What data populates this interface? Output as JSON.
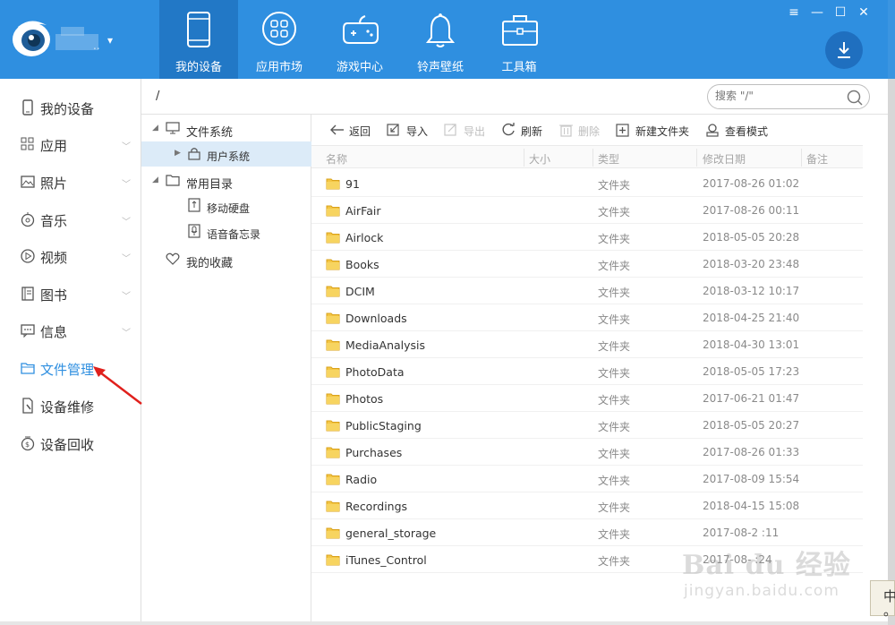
{
  "header": {
    "account_name": "..",
    "nav_tabs": [
      {
        "label": "我的设备",
        "icon": "phone-icon",
        "active": true
      },
      {
        "label": "应用市场",
        "icon": "app-grid-icon",
        "active": false
      },
      {
        "label": "游戏中心",
        "icon": "gamepad-icon",
        "active": false
      },
      {
        "label": "铃声壁纸",
        "icon": "bell-icon",
        "active": false
      },
      {
        "label": "工具箱",
        "icon": "toolbox-icon",
        "active": false
      }
    ],
    "window_controls": [
      "≡",
      "—",
      "☐",
      "✕"
    ],
    "colors": {
      "bar": "#2f8fe0",
      "active_tab": "#2278c6"
    }
  },
  "sidebar": {
    "items": [
      {
        "label": "我的设备",
        "icon": "device-icon",
        "has_chevron": false
      },
      {
        "label": "应用",
        "icon": "apps-icon",
        "has_chevron": true
      },
      {
        "label": "照片",
        "icon": "photo-icon",
        "has_chevron": true
      },
      {
        "label": "音乐",
        "icon": "music-icon",
        "has_chevron": true
      },
      {
        "label": "视频",
        "icon": "video-icon",
        "has_chevron": true
      },
      {
        "label": "图书",
        "icon": "book-icon",
        "has_chevron": true
      },
      {
        "label": "信息",
        "icon": "message-icon",
        "has_chevron": true
      },
      {
        "label": "文件管理",
        "icon": "folder-icon",
        "has_chevron": false,
        "active": true
      },
      {
        "label": "设备维修",
        "icon": "repair-icon",
        "has_chevron": false
      },
      {
        "label": "设备回收",
        "icon": "recycle-icon",
        "has_chevron": false
      }
    ],
    "active_color": "#2f8fe0"
  },
  "path": {
    "current": "/",
    "search_placeholder": "搜索 \"/\""
  },
  "tree": {
    "file_system": "文件系统",
    "user_system": "用户系统",
    "common_dirs": "常用目录",
    "mobile_disk": "移动硬盘",
    "voice_memo": "语音备忘录",
    "favorites": "我的收藏"
  },
  "toolbar": {
    "back": "返回",
    "import": "导入",
    "export": "导出",
    "refresh": "刷新",
    "delete": "删除",
    "new_folder": "新建文件夹",
    "view_mode": "查看模式"
  },
  "table": {
    "headers": {
      "name": "名称",
      "size": "大小",
      "type": "类型",
      "modified": "修改日期",
      "note": "备注"
    },
    "rows": [
      {
        "name": "91",
        "type": "文件夹",
        "date": "2017-08-26 01:02"
      },
      {
        "name": "AirFair",
        "type": "文件夹",
        "date": "2017-08-26 00:11"
      },
      {
        "name": "Airlock",
        "type": "文件夹",
        "date": "2018-05-05 20:28"
      },
      {
        "name": "Books",
        "type": "文件夹",
        "date": "2018-03-20 23:48"
      },
      {
        "name": "DCIM",
        "type": "文件夹",
        "date": "2018-03-12 10:17"
      },
      {
        "name": "Downloads",
        "type": "文件夹",
        "date": "2018-04-25 21:40"
      },
      {
        "name": "MediaAnalysis",
        "type": "文件夹",
        "date": "2018-04-30 13:01"
      },
      {
        "name": "PhotoData",
        "type": "文件夹",
        "date": "2018-05-05 17:23"
      },
      {
        "name": "Photos",
        "type": "文件夹",
        "date": "2017-06-21 01:47"
      },
      {
        "name": "PublicStaging",
        "type": "文件夹",
        "date": "2018-05-05 20:27"
      },
      {
        "name": "Purchases",
        "type": "文件夹",
        "date": "2017-08-26 01:33"
      },
      {
        "name": "Radio",
        "type": "文件夹",
        "date": "2017-08-09 15:54"
      },
      {
        "name": "Recordings",
        "type": "文件夹",
        "date": "2018-04-15 15:08"
      },
      {
        "name": "general_storage",
        "type": "文件夹",
        "date": "2017-08-2 :11"
      },
      {
        "name": "iTunes_Control",
        "type": "文件夹",
        "date": "2017-08- :24"
      }
    ]
  },
  "watermark": {
    "brand": "Bai du 经验",
    "url": "jingyan.baidu.com"
  },
  "ime": {
    "char": "中",
    "dot": "。"
  }
}
